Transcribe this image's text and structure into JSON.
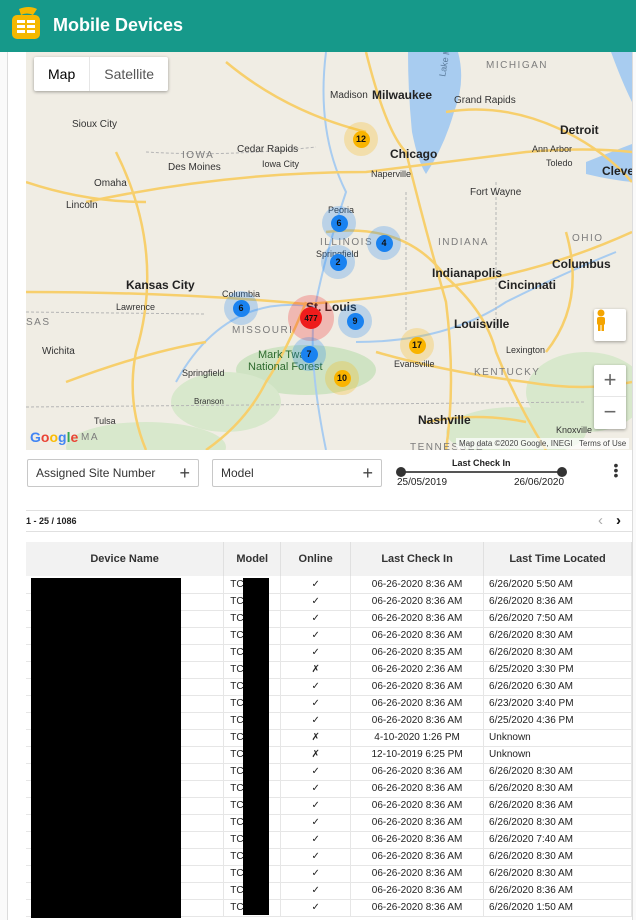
{
  "app": {
    "title": "Mobile Devices"
  },
  "map": {
    "type_control": {
      "map_label": "Map",
      "satellite_label": "Satellite",
      "selected": "Map"
    },
    "google_logo": "Google",
    "attribution": "Map data ©2020 Google, INEGI",
    "terms": "Terms of Use",
    "zoom_in": "+",
    "zoom_out": "−",
    "places": {
      "michigan": "MICHIGAN",
      "iowa": "IOWA",
      "illinois": "ILLINOIS",
      "indiana": "INDIANA",
      "ohio": "OHIO",
      "missouri": "MISSOURI",
      "kentucky": "KENTUCKY",
      "tennessee": "TENNESSEE",
      "kansas_clip": "SAS",
      "milwaukee": "Milwaukee",
      "madison": "Madison",
      "grand_rapids": "Grand Rapids",
      "detroit": "Detroit",
      "ann_arbor": "Ann Arbor",
      "toledo": "Toledo",
      "cleveland": "Clevel",
      "sioux_city": "Sioux City",
      "cedar_rapids": "Cedar Rapids",
      "iowa_city": "Iowa City",
      "des_moines": "Des Moines",
      "chicago": "Chicago",
      "naperville": "Naperville",
      "omaha": "Omaha",
      "lincoln": "Lincoln",
      "fort_wayne": "Fort Wayne",
      "peoria": "Peoria",
      "springfield_il": "Springfield",
      "indianapolis": "Indianapolis",
      "columbus": "Columbus",
      "kansas_city": "Kansas City",
      "lawrence": "Lawrence",
      "columbia": "Columbia",
      "st_louis": "St. Louis",
      "cincinnati": "Cincinnati",
      "louisville": "Louisville",
      "evansville": "Evansville",
      "lexington": "Lexington",
      "wichita": "Wichita",
      "springfield_mo": "Springfield",
      "mark_twain": "Mark Twain",
      "national_forest": "National Forest",
      "branson": "Branson",
      "tulsa": "Tulsa",
      "nashville": "Nashville",
      "knoxville": "Knoxville",
      "ma_clip": "MA",
      "lake": "Lake M"
    },
    "clusters": [
      {
        "count": "12",
        "color": "#f9b400"
      },
      {
        "count": "6",
        "color": "#1a82f0"
      },
      {
        "count": "4",
        "color": "#1a82f0"
      },
      {
        "count": "2",
        "color": "#1a82f0"
      },
      {
        "count": "6",
        "color": "#1a82f0"
      },
      {
        "count": "477",
        "color": "#ee1c1c"
      },
      {
        "count": "9",
        "color": "#1a82f0"
      },
      {
        "count": "17",
        "color": "#f9b400"
      },
      {
        "count": "7",
        "color": "#1a82f0"
      },
      {
        "count": "10",
        "color": "#f9b400"
      }
    ]
  },
  "filters": {
    "site": {
      "label": "Assigned Site Number",
      "icon": "plus-icon"
    },
    "model": {
      "label": "Model",
      "icon": "plus-icon"
    },
    "last_check_in": {
      "title": "Last Check In",
      "start": "25/05/2019",
      "end": "26/06/2020"
    }
  },
  "pager": {
    "range": "1 - 25 / 1086",
    "prev_icon": "chevron-left-icon",
    "next_icon": "chevron-right-icon"
  },
  "table": {
    "headers": [
      "Device Name",
      "Model",
      "Online",
      "Last Check In",
      "Last Time Located"
    ],
    "rows": [
      {
        "model": "TC",
        "online": "✓",
        "check": "06-26-2020 8:36 AM",
        "located": "6/26/2020 5:50 AM"
      },
      {
        "model": "TC",
        "online": "✓",
        "check": "06-26-2020 8:36 AM",
        "located": "6/26/2020 8:36 AM"
      },
      {
        "model": "TC",
        "online": "✓",
        "check": "06-26-2020 8:36 AM",
        "located": "6/26/2020 7:50 AM"
      },
      {
        "model": "TC",
        "online": "✓",
        "check": "06-26-2020 8:36 AM",
        "located": "6/26/2020 8:30 AM"
      },
      {
        "model": "TC",
        "online": "✓",
        "check": "06-26-2020 8:35 AM",
        "located": "6/26/2020 8:30 AM"
      },
      {
        "model": "TC",
        "online": "✗",
        "check": "06-26-2020 2:36 AM",
        "located": "6/25/2020 3:30 PM"
      },
      {
        "model": "TC",
        "online": "✓",
        "check": "06-26-2020 8:36 AM",
        "located": "6/26/2020 6:30 AM"
      },
      {
        "model": "TC",
        "online": "✓",
        "check": "06-26-2020 8:36 AM",
        "located": "6/23/2020 3:40 PM"
      },
      {
        "model": "TC",
        "online": "✓",
        "check": "06-26-2020 8:36 AM",
        "located": "6/25/2020 4:36 PM"
      },
      {
        "model": "TC",
        "online": "✗",
        "check": "4-10-2020 1:26 PM",
        "located": "Unknown"
      },
      {
        "model": "TC",
        "online": "✗",
        "check": "12-10-2019 6:25 PM",
        "located": "Unknown"
      },
      {
        "model": "TC",
        "online": "✓",
        "check": "06-26-2020 8:36 AM",
        "located": "6/26/2020 8:30 AM"
      },
      {
        "model": "TC",
        "online": "✓",
        "check": "06-26-2020 8:36 AM",
        "located": "6/26/2020 8:30 AM"
      },
      {
        "model": "TC",
        "online": "✓",
        "check": "06-26-2020 8:36 AM",
        "located": "6/26/2020 8:36 AM"
      },
      {
        "model": "TC",
        "online": "✓",
        "check": "06-26-2020 8:36 AM",
        "located": "6/26/2020 8:30 AM"
      },
      {
        "model": "TC",
        "online": "✓",
        "check": "06-26-2020 8:36 AM",
        "located": "6/26/2020 7:40 AM"
      },
      {
        "model": "TC",
        "online": "✓",
        "check": "06-26-2020 8:36 AM",
        "located": "6/26/2020 8:30 AM"
      },
      {
        "model": "TC",
        "online": "✓",
        "check": "06-26-2020 8:36 AM",
        "located": "6/26/2020 8:30 AM"
      },
      {
        "model": "TC",
        "online": "✓",
        "check": "06-26-2020 8:36 AM",
        "located": "6/26/2020 8:36 AM"
      },
      {
        "model": "TC",
        "online": "✓",
        "check": "06-26-2020 8:36 AM",
        "located": "6/26/2020 1:50 AM"
      }
    ]
  }
}
